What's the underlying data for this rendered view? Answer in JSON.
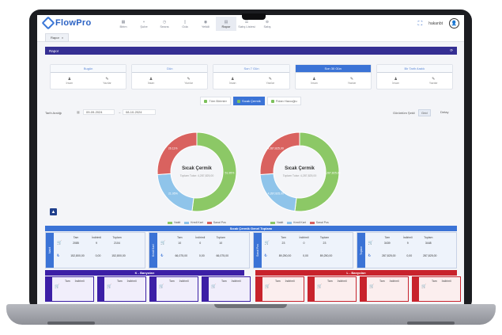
{
  "app": {
    "logo_text": "FlowPro",
    "nav": [
      {
        "label": "Birim",
        "icon": "grid-icon"
      },
      {
        "label": "Şube",
        "icon": "branch-icon"
      },
      {
        "label": "Seans",
        "icon": "clock-icon"
      },
      {
        "label": "Oda",
        "icon": "door-icon"
      },
      {
        "label": "Yetkili",
        "icon": "user-icon"
      },
      {
        "label": "Rapor",
        "icon": "report-icon"
      },
      {
        "label": "Satış Listesi",
        "icon": "list-icon"
      },
      {
        "label": "Satış",
        "icon": "cart-icon"
      }
    ],
    "active_nav": "Rapor",
    "user_name": "hakanbt"
  },
  "tab": {
    "label": "Rapor"
  },
  "header": {
    "title": "Rapor"
  },
  "periods": [
    {
      "label": "Bugün",
      "active": false
    },
    {
      "label": "Dün",
      "active": false
    },
    {
      "label": "Son 7 Gün",
      "active": false
    },
    {
      "label": "Son 30 Gün",
      "active": true
    },
    {
      "label": "Bir Tarih Aralık",
      "active": false
    }
  ],
  "period_sub_labels": [
    "İnsan",
    "Yazılar"
  ],
  "chips": [
    {
      "label": "Tüm Birimler",
      "active": false
    },
    {
      "label": "Sıcak Çermik",
      "active": true
    },
    {
      "label": "Fidan Hacıoğlu",
      "active": false
    }
  ],
  "dates": {
    "label": "Tarih Aralığı",
    "start": "09-09-2024",
    "end": "08-10-2024",
    "view_label": "Görüntüm Şekli",
    "view_grid": "Grid",
    "view_detail": "Detay"
  },
  "charts": [
    {
      "title": "Sıcak Çermik",
      "subtitle": "Toplam Tutar: 4,287,825,00",
      "slices": [
        {
          "name": "Nakit",
          "value": 51.95,
          "label": "51.95%",
          "color": "#8cc866"
        },
        {
          "name": "Kredi Kart",
          "value": 21.95,
          "label": "21.95%",
          "color": "#8fc4ea"
        },
        {
          "name": "Sanal Pos",
          "value": 26.11,
          "label": "26.11%",
          "color": "#d9625f"
        }
      ]
    },
    {
      "title": "Sıcak Çermik",
      "subtitle": "Toplam Tutar: 4,287,825,00",
      "slices": [
        {
          "name": "Nakit",
          "value": 51.95,
          "label": "4,287,825,00",
          "color": "#8cc866"
        },
        {
          "name": "Kredi Kart",
          "value": 21.95,
          "label": "4,287,825,00",
          "color": "#8fc4ea"
        },
        {
          "name": "Sanal Pos",
          "value": 26.11,
          "label": "4,287,825,00",
          "color": "#d9625f"
        }
      ]
    }
  ],
  "legend": [
    "Nakit",
    "Kredi Kart",
    "Sanal Pos"
  ],
  "summary": {
    "title": "Sıcak Çermik Genel Toplamı",
    "headers": [
      "Tam",
      "İndirimli",
      "Toplam"
    ],
    "cards": [
      {
        "side": "Nakit",
        "count": [
          "2085",
          "9",
          "2104"
        ],
        "amount": [
          "152,800,00",
          "0,00",
          "152,800,00"
        ]
      },
      {
        "side": "Kredi Kart",
        "count": [
          "10",
          "0",
          "10"
        ],
        "amount": [
          "66,075,00",
          "0,00",
          "66,075,00"
        ]
      },
      {
        "side": "Sanal Pos",
        "count": [
          "23",
          "0",
          "23"
        ],
        "amount": [
          "89,250,00",
          "0,00",
          "89,250,00"
        ]
      },
      {
        "side": "Toplam",
        "count": [
          "3439",
          "9",
          "3448"
        ],
        "amount": [
          "287,825,00",
          "0,00",
          "287,825,00"
        ]
      }
    ]
  },
  "sections": {
    "left": "K - Banyoları",
    "right": "L - Banyoları"
  },
  "colors": {
    "primary": "#3b73d6",
    "navy": "#352f93",
    "purple": "#3c1fa6",
    "red": "#c8232c"
  }
}
